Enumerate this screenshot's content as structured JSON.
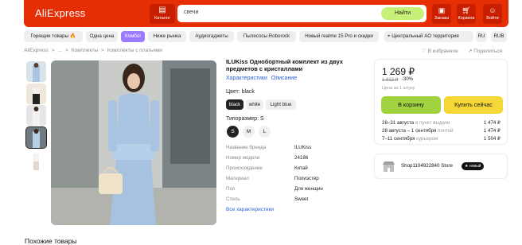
{
  "header": {
    "logo": "AliExpress",
    "catalog_label": "Каталог",
    "search_value": "свечи",
    "search_button": "Найти",
    "orders_label": "Заказы",
    "cart_label": "Корзина",
    "login_label": "Войти",
    "accent_color": "#e62e04"
  },
  "chips": [
    {
      "label": "Горящие товары 🔥"
    },
    {
      "label": "Одна цена"
    },
    {
      "label": "Комбо!"
    },
    {
      "label": "Ниже рынка"
    },
    {
      "label": "Аудиогаджеты"
    },
    {
      "label": "Пылесосы Roborock"
    },
    {
      "label": "Новый realme 15 Pro и скидки"
    }
  ],
  "region": "Центральный АО территория",
  "lang": "RU",
  "currency": "RUB",
  "breadcrumbs": [
    "AliExpress",
    ">",
    "...",
    ">",
    "Комплекты",
    ">",
    "Комплекты с платьями"
  ],
  "actions": {
    "favorite": "В избранное",
    "share": "Поделиться"
  },
  "product": {
    "title": "ILUKiss Однобортный комплект из двух предметов с кристаллами",
    "tabs": [
      "Характеристики",
      "Описание"
    ],
    "color_label": "Цвет: black",
    "colors": [
      "black",
      "white",
      "Light blue"
    ],
    "size_label": "Типоразмер: S",
    "sizes": [
      "S",
      "M",
      "L"
    ],
    "specs": [
      {
        "k": "Название бренда",
        "v": "ILUKiss"
      },
      {
        "k": "Номер модели",
        "v": "24186"
      },
      {
        "k": "Происхождение",
        "v": "Китай"
      },
      {
        "k": "Материал",
        "v": "Полиэстер"
      },
      {
        "k": "Пол",
        "v": "Для женщин"
      },
      {
        "k": "Стиль",
        "v": "Sweet"
      }
    ],
    "all_specs": "Все характеристики"
  },
  "buy": {
    "price": "1 269 ₽",
    "old_price": "1 812 ₽",
    "discount": "-30%",
    "per_unit": "Цена за 1 штуку",
    "to_cart": "В корзину",
    "buy_now": "Купить сейчас",
    "delivery": [
      {
        "date": "28–31 августа",
        "via": "в пункт выдачи",
        "price": "1 474 ₽"
      },
      {
        "date": "28 августа – 1 сентября",
        "via": "почтой",
        "price": "1 474 ₽"
      },
      {
        "date": "7–11 сентября",
        "via": "курьером",
        "price": "1 504 ₽"
      }
    ]
  },
  "store": {
    "name": "Shop1104922840 Store",
    "badge": "новый"
  },
  "similar_title": "Похожие товары"
}
